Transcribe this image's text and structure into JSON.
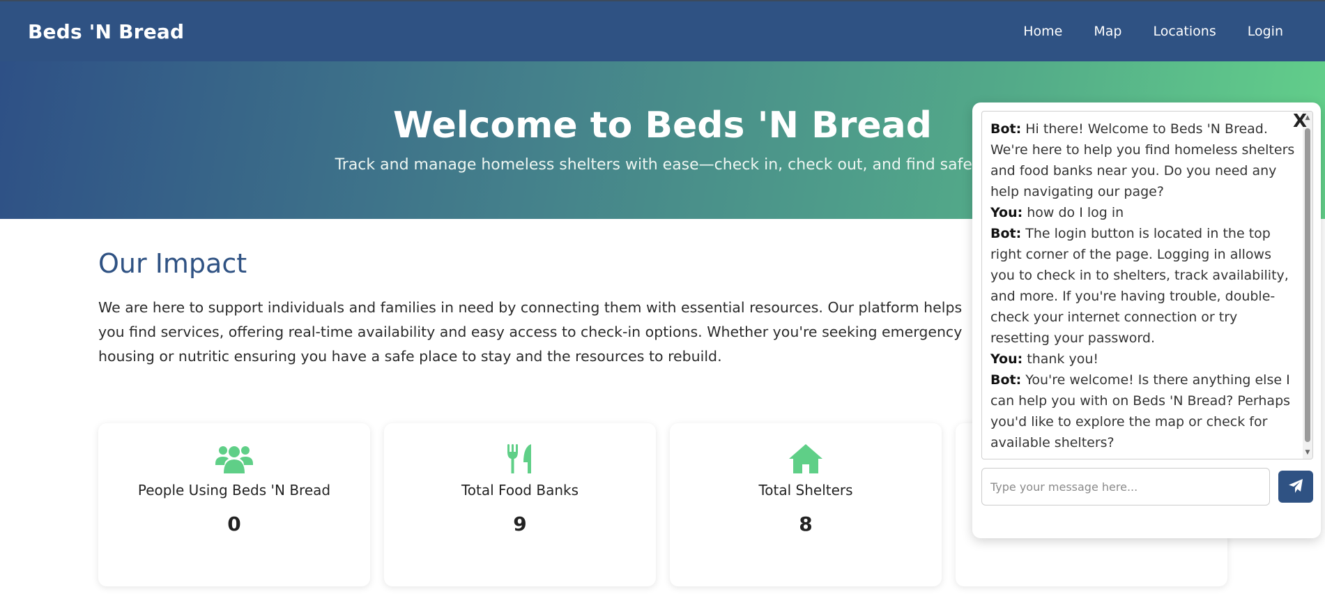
{
  "brand": "Beds 'N Bread",
  "nav": {
    "home": "Home",
    "map": "Map",
    "locations": "Locations",
    "login": "Login"
  },
  "hero": {
    "title": "Welcome to Beds 'N Bread",
    "subtitle": "Track and manage homeless shelters with ease—check in, check out, and find safety."
  },
  "impact": {
    "title": "Our Impact",
    "text": "We are here to support individuals and families in need by connecting them with essential resources. Our platform helps you find services, offering real-time availability and easy access to check-in options. Whether you're seeking emergency housing or nutritic ensuring you have a safe place to stay and the resources to rebuild."
  },
  "cards": [
    {
      "icon": "people-icon",
      "label": "People Using Beds 'N Bread",
      "value": "0"
    },
    {
      "icon": "utensils-icon",
      "label": "Total Food Banks",
      "value": "9"
    },
    {
      "icon": "home-icon",
      "label": "Total Shelters",
      "value": "8"
    },
    {
      "icon": "",
      "label": "",
      "value": ""
    }
  ],
  "chat": {
    "close_label": "X",
    "messages": [
      {
        "speaker": "Bot:",
        "text": " Hi there! Welcome to Beds 'N Bread. We're here to help you find homeless shelters and food banks near you. Do you need any help navigating our page?"
      },
      {
        "speaker": "You:",
        "text": " how do I log in"
      },
      {
        "speaker": "Bot:",
        "text": " The login button is located in the top right corner of the page. Logging in allows you to check in to shelters, track availability, and more. If you're having trouble, double-check your internet connection or try resetting your password."
      },
      {
        "speaker": "You:",
        "text": " thank you!"
      },
      {
        "speaker": "Bot:",
        "text": " You're welcome! Is there anything else I can help you with on Beds 'N Bread? Perhaps you'd like to explore the map or check for available shelters?"
      }
    ],
    "input_placeholder": "Type your message here...",
    "send_icon": "paper-plane-icon"
  },
  "colors": {
    "navy": "#2f5283",
    "green": "#5fcf87"
  }
}
